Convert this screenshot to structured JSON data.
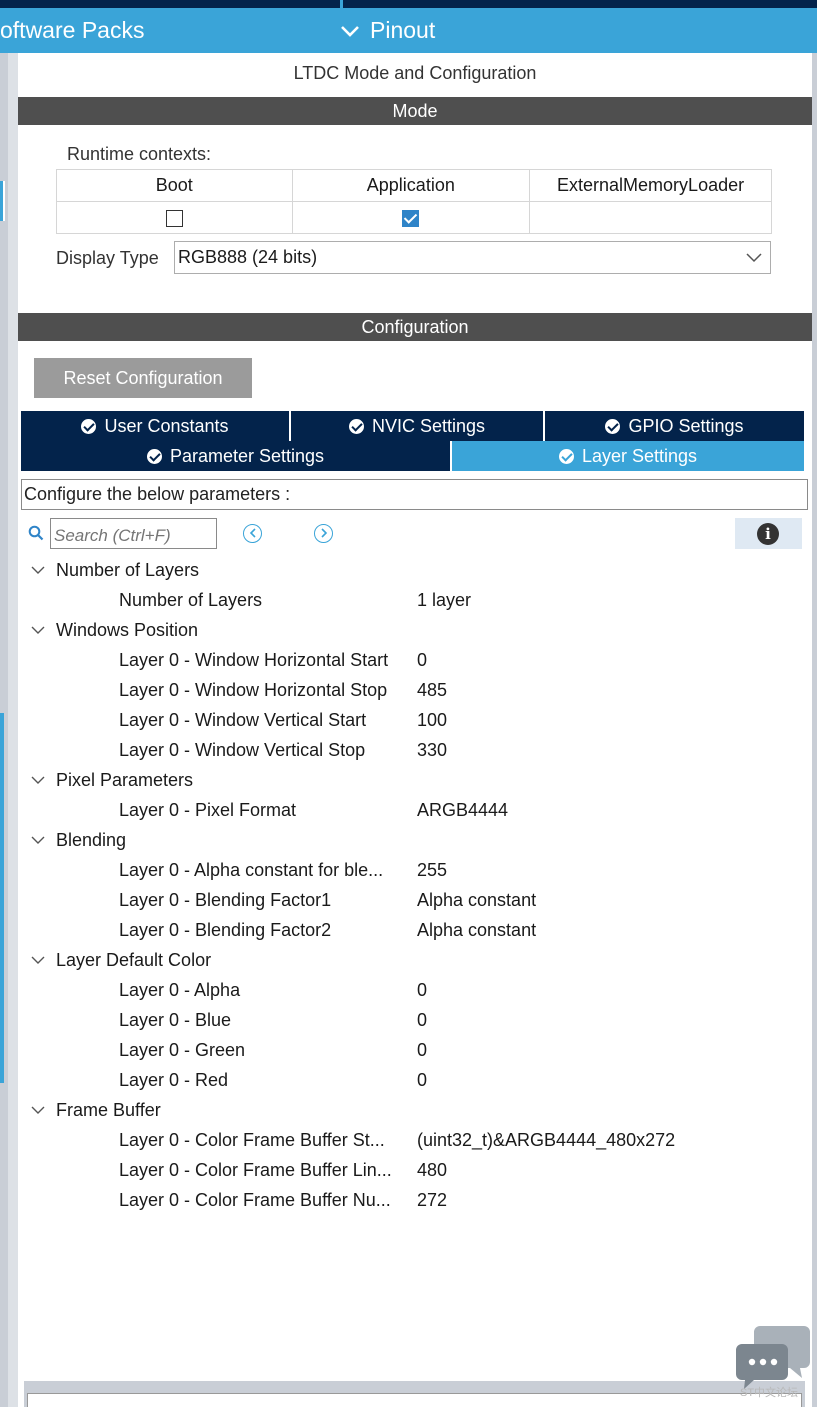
{
  "topbar": {
    "software_packs": "oftware Packs",
    "pinout": "Pinout"
  },
  "panel": {
    "title": "LTDC Mode and Configuration",
    "mode_header": "Mode",
    "runtime_contexts_label": "Runtime contexts:",
    "contexts": [
      {
        "label": "Boot",
        "checked": false
      },
      {
        "label": "Application",
        "checked": true
      },
      {
        "label": "ExternalMemoryLoader",
        "checked": null
      }
    ],
    "display_type_label": "Display Type",
    "display_type_value": "RGB888 (24 bits)",
    "configuration_header": "Configuration",
    "reset_button": "Reset Configuration"
  },
  "tabs": {
    "row1": [
      {
        "label": "User Constants",
        "active": false
      },
      {
        "label": "NVIC Settings",
        "active": false
      },
      {
        "label": "GPIO Settings",
        "active": false
      }
    ],
    "row2": [
      {
        "label": "Parameter Settings",
        "active": false
      },
      {
        "label": "Layer Settings",
        "active": true
      }
    ]
  },
  "config_hint": "Configure the below parameters :",
  "search": {
    "placeholder": "Search (Ctrl+F)"
  },
  "info_icon": "i",
  "groups": [
    {
      "name": "Number of Layers",
      "params": [
        {
          "name": "Number of Layers",
          "value": "1 layer"
        }
      ]
    },
    {
      "name": "Windows Position",
      "params": [
        {
          "name": "Layer 0 - Window Horizontal Start",
          "value": "0"
        },
        {
          "name": "Layer 0 - Window Horizontal Stop",
          "value": "485"
        },
        {
          "name": "Layer 0 - Window Vertical Start",
          "value": "100"
        },
        {
          "name": "Layer 0 - Window Vertical Stop",
          "value": "330"
        }
      ]
    },
    {
      "name": "Pixel Parameters",
      "params": [
        {
          "name": "Layer 0 - Pixel Format",
          "value": "ARGB4444"
        }
      ]
    },
    {
      "name": "Blending",
      "params": [
        {
          "name": "Layer 0 - Alpha constant for ble...",
          "value": "255"
        },
        {
          "name": "Layer 0 - Blending Factor1",
          "value": "Alpha constant"
        },
        {
          "name": "Layer 0 - Blending Factor2",
          "value": "Alpha constant"
        }
      ]
    },
    {
      "name": "Layer Default Color",
      "params": [
        {
          "name": "Layer 0 - Alpha",
          "value": "0"
        },
        {
          "name": "Layer 0 - Blue",
          "value": "0"
        },
        {
          "name": "Layer 0 - Green",
          "value": "0"
        },
        {
          "name": "Layer 0 - Red",
          "value": "0"
        }
      ]
    },
    {
      "name": "Frame Buffer",
      "params": [
        {
          "name": "Layer 0 - Color Frame Buffer St...",
          "value": "(uint32_t)&ARGB4444_480x272"
        },
        {
          "name": "Layer 0 - Color Frame Buffer Lin...",
          "value": "480"
        },
        {
          "name": "Layer 0 - Color Frame Buffer Nu...",
          "value": "272"
        }
      ]
    }
  ],
  "watermark": "ST中文论坛",
  "colors": {
    "accent": "#3aa4d8",
    "navy": "#03234b",
    "header_gray": "#4f4f4f",
    "button_gray": "#9b9b9b",
    "checkbox_blue": "#2f84c8"
  }
}
